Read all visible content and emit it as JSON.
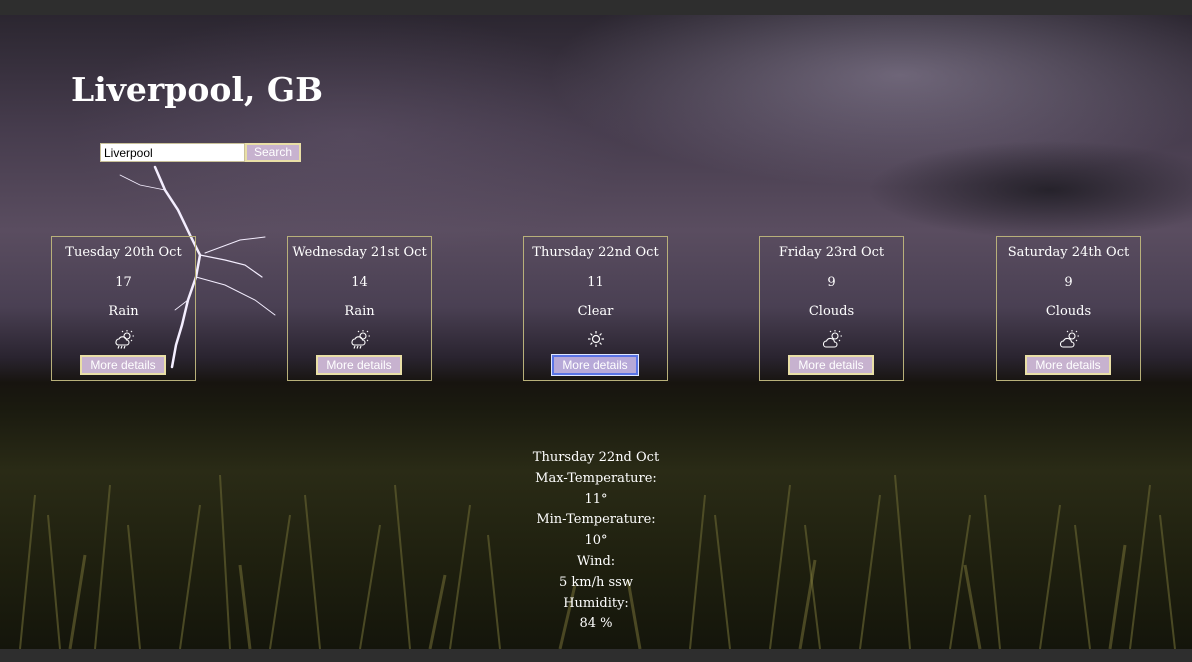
{
  "city": "Liverpool, GB",
  "search": {
    "value": "Liverpool",
    "button_label": "Search"
  },
  "forecast": [
    {
      "date": "Tuesday 20th Oct",
      "temp": "17",
      "condition": "Rain",
      "icon": "rain-sun-icon",
      "button": "More details"
    },
    {
      "date": "Wednesday 21st Oct",
      "temp": "14",
      "condition": "Rain",
      "icon": "rain-sun-icon",
      "button": "More details"
    },
    {
      "date": "Thursday 22nd Oct",
      "temp": "11",
      "condition": "Clear",
      "icon": "sun-icon",
      "button": "More details"
    },
    {
      "date": "Friday 23rd Oct",
      "temp": "9",
      "condition": "Clouds",
      "icon": "cloud-sun-icon",
      "button": "More details"
    },
    {
      "date": "Saturday 24th Oct",
      "temp": "9",
      "condition": "Clouds",
      "icon": "cloud-sun-icon",
      "button": "More details"
    }
  ],
  "details": {
    "date": "Thursday 22nd Oct",
    "max_label": "Max-Temperature:",
    "max_value": "11°",
    "min_label": "Min-Temperature:",
    "min_value": "10°",
    "wind_label": "Wind:",
    "wind_value": "5 km/h ssw",
    "humidity_label": "Humidity:",
    "humidity_value": "84 %"
  },
  "colors": {
    "card_border": "#b8b07a",
    "button_bg": "#c7b2cf",
    "button_border": "#e9dfa6",
    "active_border": "#5a74e6"
  }
}
